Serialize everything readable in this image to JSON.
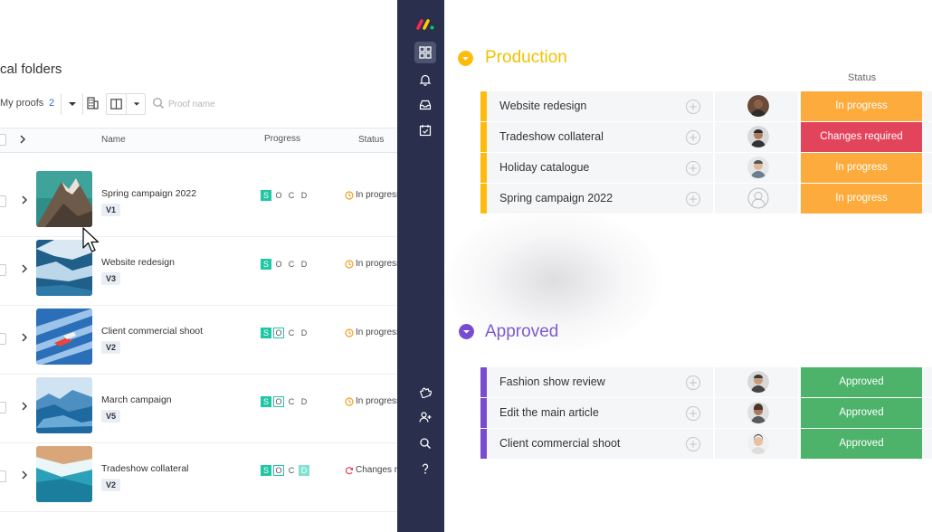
{
  "left_panel": {
    "folder_title": "cal folders",
    "toolbar": {
      "my_proofs_label": "My proofs",
      "my_proofs_count": "2",
      "search_placeholder": "Proof name"
    },
    "table": {
      "headers": {
        "name": "Name",
        "progress": "Progress",
        "status": "Status"
      },
      "rows": [
        {
          "name": "Spring campaign 2022",
          "version": "V1",
          "stages": [
            "S",
            "O",
            "C",
            "D"
          ],
          "stage_states": [
            "done",
            "pending",
            "pending",
            "pending"
          ],
          "status": "In progress",
          "status_icon": "clock-icon",
          "thumb_icon": "mountain-image"
        },
        {
          "name": "Website redesign",
          "version": "V3",
          "stages": [
            "S",
            "O",
            "C",
            "D"
          ],
          "stage_states": [
            "done",
            "pending",
            "pending",
            "pending"
          ],
          "status": "In progress",
          "status_icon": "clock-icon",
          "thumb_icon": "glacier-image"
        },
        {
          "name": "Client commercial shoot",
          "version": "V2",
          "stages": [
            "S",
            "O",
            "C",
            "D"
          ],
          "stage_states": [
            "done",
            "active",
            "pending",
            "pending"
          ],
          "status": "In progress",
          "status_icon": "clock-icon",
          "thumb_icon": "shoes-image"
        },
        {
          "name": "March campaign",
          "version": "V5",
          "stages": [
            "S",
            "O",
            "C",
            "D"
          ],
          "stage_states": [
            "done",
            "active",
            "pending",
            "pending"
          ],
          "status": "In progress",
          "status_icon": "clock-icon",
          "thumb_icon": "mountains-image"
        },
        {
          "name": "Tradeshow collateral",
          "version": "V2",
          "stages": [
            "S",
            "O",
            "C",
            "D"
          ],
          "stage_states": [
            "done",
            "active",
            "pending",
            "light"
          ],
          "status": "Changes required",
          "status_icon": "refresh-icon",
          "thumb_icon": "beach-image"
        }
      ]
    }
  },
  "sidebar": {
    "items": [
      "grid-icon",
      "bell-icon",
      "inbox-icon",
      "calendar-check-icon"
    ],
    "bottom_items": [
      "puzzle-icon",
      "add-user-icon",
      "search-icon",
      "help-icon"
    ]
  },
  "board": {
    "status_column_label": "Status",
    "groups": [
      {
        "title": "Production",
        "color": "#fdbc0c",
        "items": [
          {
            "name": "Website redesign",
            "status": "In progress",
            "status_color": "#fdab3d"
          },
          {
            "name": "Tradeshow collateral",
            "status": "Changes required",
            "status_color": "#e2445c"
          },
          {
            "name": "Holiday catalogue",
            "status": "In progress",
            "status_color": "#fdab3d"
          },
          {
            "name": "Spring campaign 2022",
            "status": "In progress",
            "status_color": "#fdab3d"
          }
        ]
      },
      {
        "title": "Approved",
        "color": "#784bd1",
        "items": [
          {
            "name": "Fashion show review",
            "status": "Approved",
            "status_color": "#00c875"
          },
          {
            "name": "Edit the main article",
            "status": "Approved",
            "status_color": "#00c875"
          },
          {
            "name": "Client commercial shoot",
            "status": "Approved",
            "status_color": "#00c875"
          }
        ]
      }
    ]
  }
}
